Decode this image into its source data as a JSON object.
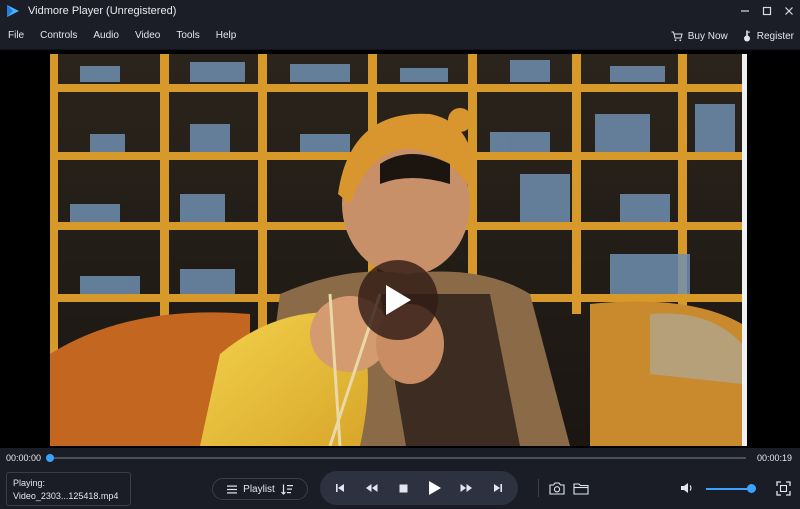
{
  "window": {
    "title": "Vidmore Player (Unregistered)"
  },
  "menu": {
    "items": [
      {
        "label": "File"
      },
      {
        "label": "Controls"
      },
      {
        "label": "Audio"
      },
      {
        "label": "Video"
      },
      {
        "label": "Tools"
      },
      {
        "label": "Help"
      }
    ],
    "buy_now": "Buy Now",
    "register": "Register"
  },
  "player": {
    "current_time": "00:00:00",
    "total_time": "00:00:19",
    "progress_fraction": 0.0,
    "volume_fraction": 0.9,
    "now_playing_label": "Playing:",
    "now_playing_file": "Video_2303...125418.mp4",
    "playlist_label": "Playlist"
  },
  "colors": {
    "accent": "#3aa3ff",
    "background": "#0d0f16",
    "toolbar": "#1b1e27"
  },
  "icons": [
    "app-logo-icon",
    "minimize-icon",
    "maximize-icon",
    "close-icon",
    "cart-icon",
    "key-icon",
    "play-icon",
    "playlist-icon",
    "sort-icon",
    "previous-icon",
    "rewind-icon",
    "stop-icon",
    "forward-icon",
    "next-icon",
    "camera-icon",
    "folder-icon",
    "volume-icon",
    "fullscreen-icon"
  ]
}
